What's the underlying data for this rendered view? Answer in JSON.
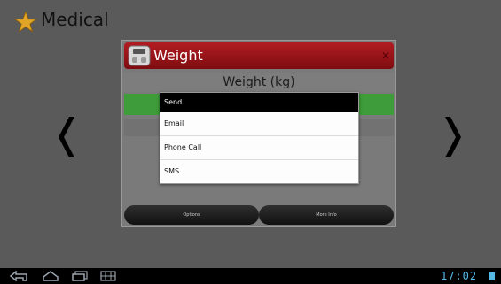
{
  "app": {
    "title": "Medical"
  },
  "panel": {
    "title": "Weight",
    "subtitle": "Weight (kg)"
  },
  "panel_buttons": {
    "options": "Options",
    "more_info": "More Info"
  },
  "send_dialog": {
    "title": "Send",
    "items": [
      "Email",
      "Phone Call",
      "SMS"
    ]
  },
  "status_bar": {
    "time": "17:02"
  },
  "icons": [
    "star-icon",
    "scale-icon",
    "back-icon",
    "home-icon",
    "recent-apps-icon",
    "menu-icon",
    "battery-icon"
  ],
  "colors": {
    "header_red": "#b11d22",
    "green_row": "#3f9c3a",
    "clock_blue": "#55b8e5"
  }
}
